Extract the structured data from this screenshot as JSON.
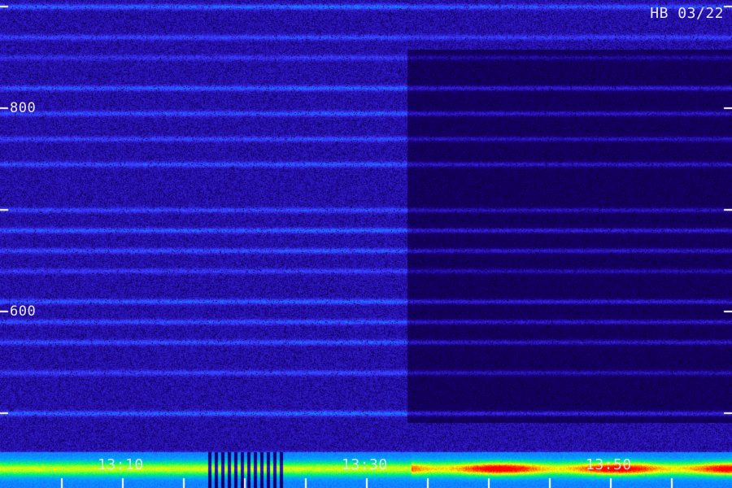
{
  "stamp": "HB 03/22",
  "chart_data": {
    "type": "heatmap",
    "title": "",
    "xlabel": "",
    "ylabel": "",
    "y_ticks": [
      800,
      600
    ],
    "y_tick_labels": [
      "800",
      "600"
    ],
    "x_tick_labels": [
      "13:10",
      "13:30",
      "13:50"
    ],
    "colormap": [
      "#000000",
      "#1a0080",
      "#3c32ff",
      "#00a0ff",
      "#00ff60",
      "#ffff00",
      "#ff0000"
    ],
    "bands": [
      {
        "y": 900,
        "intensity": 0.55
      },
      {
        "y": 870,
        "intensity": 0.4
      },
      {
        "y": 850,
        "intensity": 0.3
      },
      {
        "y": 820,
        "intensity": 0.5
      },
      {
        "y": 795,
        "intensity": 0.45
      },
      {
        "y": 770,
        "intensity": 0.4
      },
      {
        "y": 745,
        "intensity": 0.45
      },
      {
        "y": 700,
        "intensity": 0.4
      },
      {
        "y": 680,
        "intensity": 0.5
      },
      {
        "y": 660,
        "intensity": 0.45
      },
      {
        "y": 640,
        "intensity": 0.35
      },
      {
        "y": 610,
        "intensity": 0.5
      },
      {
        "y": 590,
        "intensity": 0.45
      },
      {
        "y": 570,
        "intensity": 0.45
      },
      {
        "y": 540,
        "intensity": 0.4
      },
      {
        "y": 500,
        "intensity": 0.55
      },
      {
        "y": 460,
        "intensity": 0.45
      }
    ]
  }
}
